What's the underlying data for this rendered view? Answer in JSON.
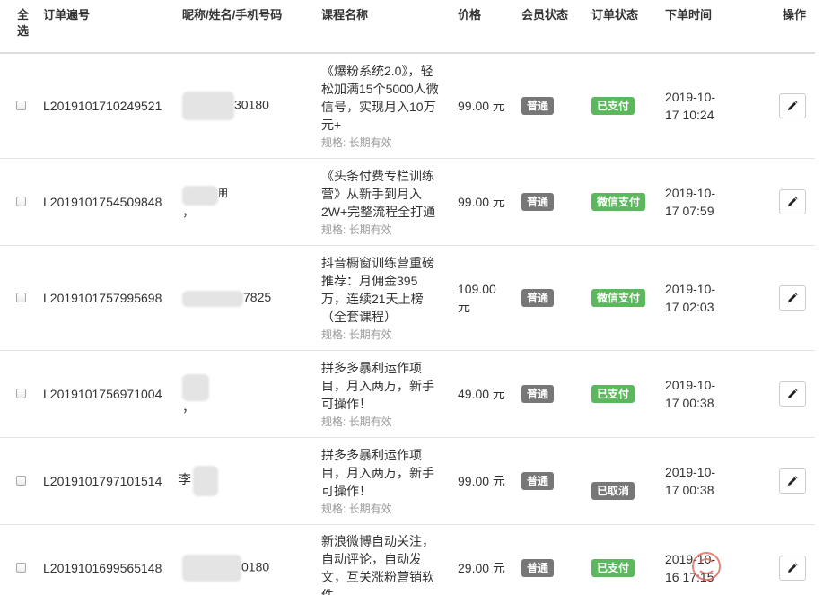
{
  "header": {
    "select_all": "全选",
    "order_no": "订单遍号",
    "nickname": "昵称/姓名/手机号码",
    "course_name": "课程名称",
    "price": "价格",
    "member_status": "会员状态",
    "order_status": "订单状态",
    "order_time": "下单时间",
    "operation": "操作"
  },
  "spec_prefix": "规格: 长期有效",
  "colors": {
    "paid_badge": "#5cb85c",
    "neutral_badge": "#777777",
    "spec_text": "#999999",
    "watermark": "#e05a4e"
  },
  "rows": [
    {
      "order_no": "L2019101710249521",
      "name_visible": "30180",
      "course_lines": [
        "《爆粉系统2.0》，轻",
        "松加满15个5000人微",
        "信号，实现月入10万",
        "元+"
      ],
      "spec": "规格: 长期有效",
      "price_lines": [
        "99.00 元"
      ],
      "member": "普通",
      "status": "已支付",
      "time_lines": [
        "2019-10-",
        "17 10:24"
      ]
    },
    {
      "order_no": "L2019101754509848",
      "name_visible": "朋",
      "name_tail": "，",
      "course_lines": [
        "《头条付费专栏训练",
        "营》从新手到月入",
        "2W+完整流程全打通"
      ],
      "spec": "规格: 长期有效",
      "price_lines": [
        "99.00 元"
      ],
      "member": "普通",
      "status": "微信支付",
      "time_lines": [
        "2019-10-",
        "17 07:59"
      ]
    },
    {
      "order_no": "L2019101757995698",
      "name_visible": "7825",
      "course_lines": [
        "抖音橱窗训练营重磅",
        "推荐：月佣金395",
        "万，连续21天上榜",
        "（全套课程）"
      ],
      "spec": "规格: 长期有效",
      "price_lines": [
        "109.00",
        "元"
      ],
      "member": "普通",
      "status": "微信支付",
      "time_lines": [
        "2019-10-",
        "17 02:03"
      ]
    },
    {
      "order_no": "L2019101756971004",
      "name_visible": "",
      "name_tail": "，",
      "course_lines": [
        "拼多多暴利运作项",
        "目，月入两万，新手",
        "可操作！"
      ],
      "spec": "规格: 长期有效",
      "price_lines": [
        "49.00 元"
      ],
      "member": "普通",
      "status": "已支付",
      "time_lines": [
        "2019-10-",
        "17 00:38"
      ]
    },
    {
      "order_no": "L2019101797101514",
      "name_visible": "李",
      "course_lines": [
        "拼多多暴利运作项",
        "目，月入两万，新手",
        "可操作！"
      ],
      "spec": "规格: 长期有效",
      "price_lines": [
        "99.00 元"
      ],
      "member": "普通",
      "status": "已取消",
      "time_lines": [
        "2019-10-",
        "17 00:38"
      ]
    },
    {
      "order_no": "L2019101699565148",
      "name_visible": "0180",
      "course_lines": [
        "新浪微博自动关注，",
        "自动评论，自动发",
        "文，互关涨粉营销软",
        "件"
      ],
      "spec": "",
      "price_lines": [
        "29.00 元"
      ],
      "member": "普通",
      "status": "已支付",
      "time_lines": [
        "2019-10-",
        "16 17:15"
      ]
    }
  ]
}
